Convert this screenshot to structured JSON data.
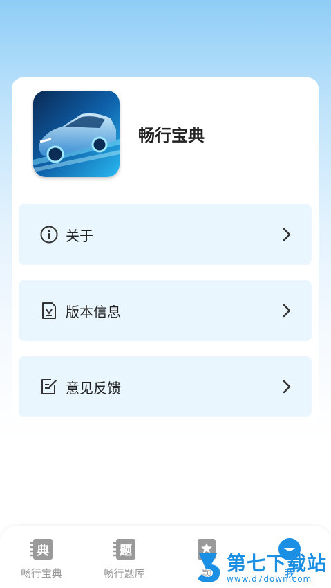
{
  "app": {
    "name": "畅行宝典"
  },
  "menu": [
    {
      "label": "关于",
      "icon": "info-icon"
    },
    {
      "label": "版本信息",
      "icon": "version-doc-icon"
    },
    {
      "label": "意见反馈",
      "icon": "feedback-edit-icon"
    }
  ],
  "tabbar": {
    "tabs": [
      {
        "label": "畅行宝典",
        "icon": "book-icon",
        "glyph": "典"
      },
      {
        "label": "畅行题库",
        "icon": "question-bank-icon",
        "glyph": "题"
      },
      {
        "label": "题",
        "icon": "star-icon"
      },
      {
        "label": "我",
        "icon": "profile-icon"
      }
    ]
  },
  "watermark": {
    "title": "第七下载站",
    "url": "www.d7down.com"
  },
  "colors": {
    "accent": "#1a8fe3",
    "menu_bg": "#eaf6fe",
    "inactive": "#999999"
  }
}
